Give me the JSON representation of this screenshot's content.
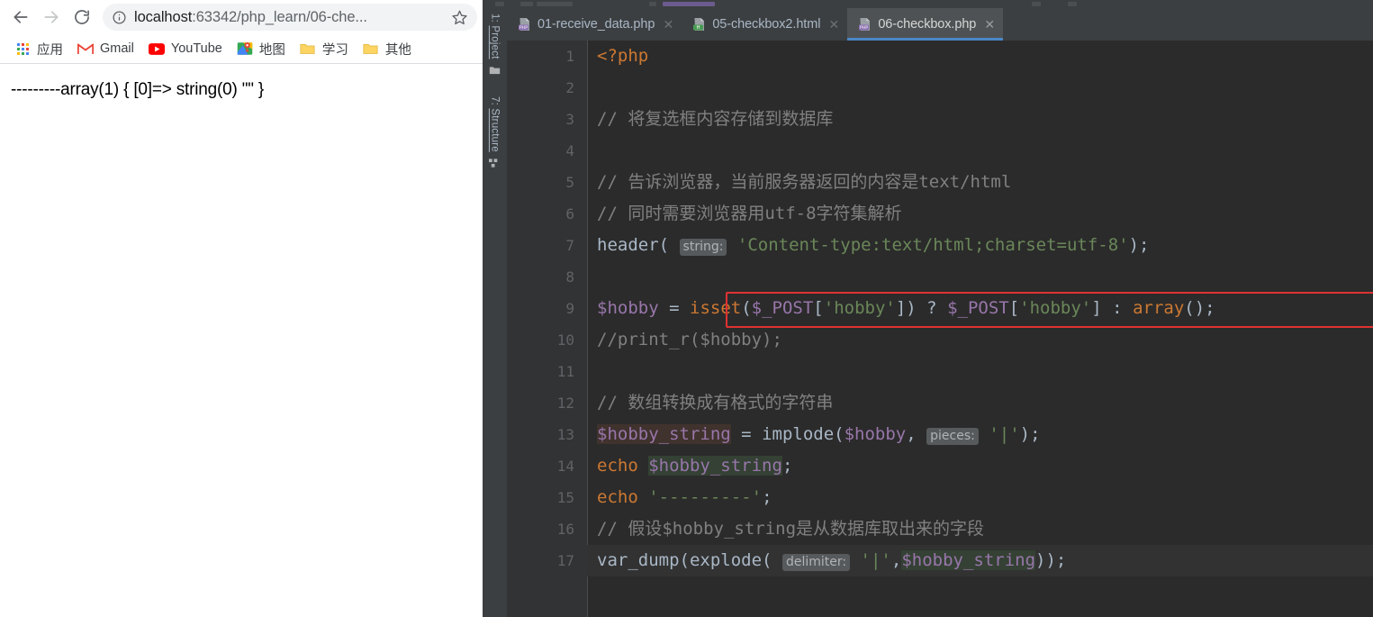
{
  "browser": {
    "nav": {
      "back_label": "Back",
      "forward_label": "Forward",
      "reload_label": "Reload"
    },
    "omnibox": {
      "site_info_icon": "info-circle-icon",
      "url_host": "localhost",
      "url_path": ":63342/php_learn/06-che...",
      "url_full": "localhost:63342/php_learn/06-che...",
      "bookmark_icon": "star-icon"
    },
    "bookmarks": [
      {
        "label": "应用",
        "icon": "apps-grid-icon"
      },
      {
        "label": "Gmail",
        "icon": "gmail-icon"
      },
      {
        "label": "YouTube",
        "icon": "youtube-icon"
      },
      {
        "label": "地图",
        "icon": "google-maps-icon"
      },
      {
        "label": "学习",
        "icon": "folder-icon"
      },
      {
        "label": "其他",
        "icon": "folder-icon"
      }
    ],
    "page": {
      "output": "---------array(1) { [0]=> string(0) \"\" }"
    }
  },
  "ide": {
    "tool_rail": [
      {
        "label_num": "1:",
        "label_text": "Project",
        "icon": "folder-icon"
      },
      {
        "label_num": "7:",
        "label_text": "Structure",
        "icon": "structure-icon"
      }
    ],
    "tabs": [
      {
        "label": "01-receive_data.php",
        "icon": "php-file-icon",
        "active": false,
        "close": "✕"
      },
      {
        "label": "05-checkbox2.html",
        "icon": "html-file-icon",
        "active": false,
        "close": "✕"
      },
      {
        "label": "06-checkbox.php",
        "icon": "php-file-icon",
        "active": true,
        "close": "✕"
      }
    ],
    "editor": {
      "current_line": 17,
      "annotation_color": "#e03131",
      "line_numbers": [
        "1",
        "2",
        "3",
        "4",
        "5",
        "6",
        "7",
        "8",
        "9",
        "10",
        "11",
        "12",
        "13",
        "14",
        "15",
        "16",
        "17"
      ],
      "lines": [
        "<?php",
        "",
        "// 将复选框内容存储到数据库",
        "",
        "// 告诉浏览器，当前服务器返回的内容是text/html",
        "// 同时需要浏览器用utf-8字符集解析",
        "header( string: 'Content-type:text/html;charset=utf-8');",
        "",
        "$hobby = isset($_POST['hobby']) ? $_POST['hobby'] : array();",
        "//print_r($hobby);",
        "",
        "// 数组转换成有格式的字符串",
        "$hobby_string = implode($hobby, pieces: '|');",
        "echo $hobby_string;",
        "echo '---------';",
        "// 假设$hobby_string是从数据库取出来的字段",
        "var_dump(explode( delimiter: '|',$hobby_string));"
      ],
      "inlay_hints": [
        "string:",
        "pieces:",
        "delimiter:"
      ]
    }
  }
}
